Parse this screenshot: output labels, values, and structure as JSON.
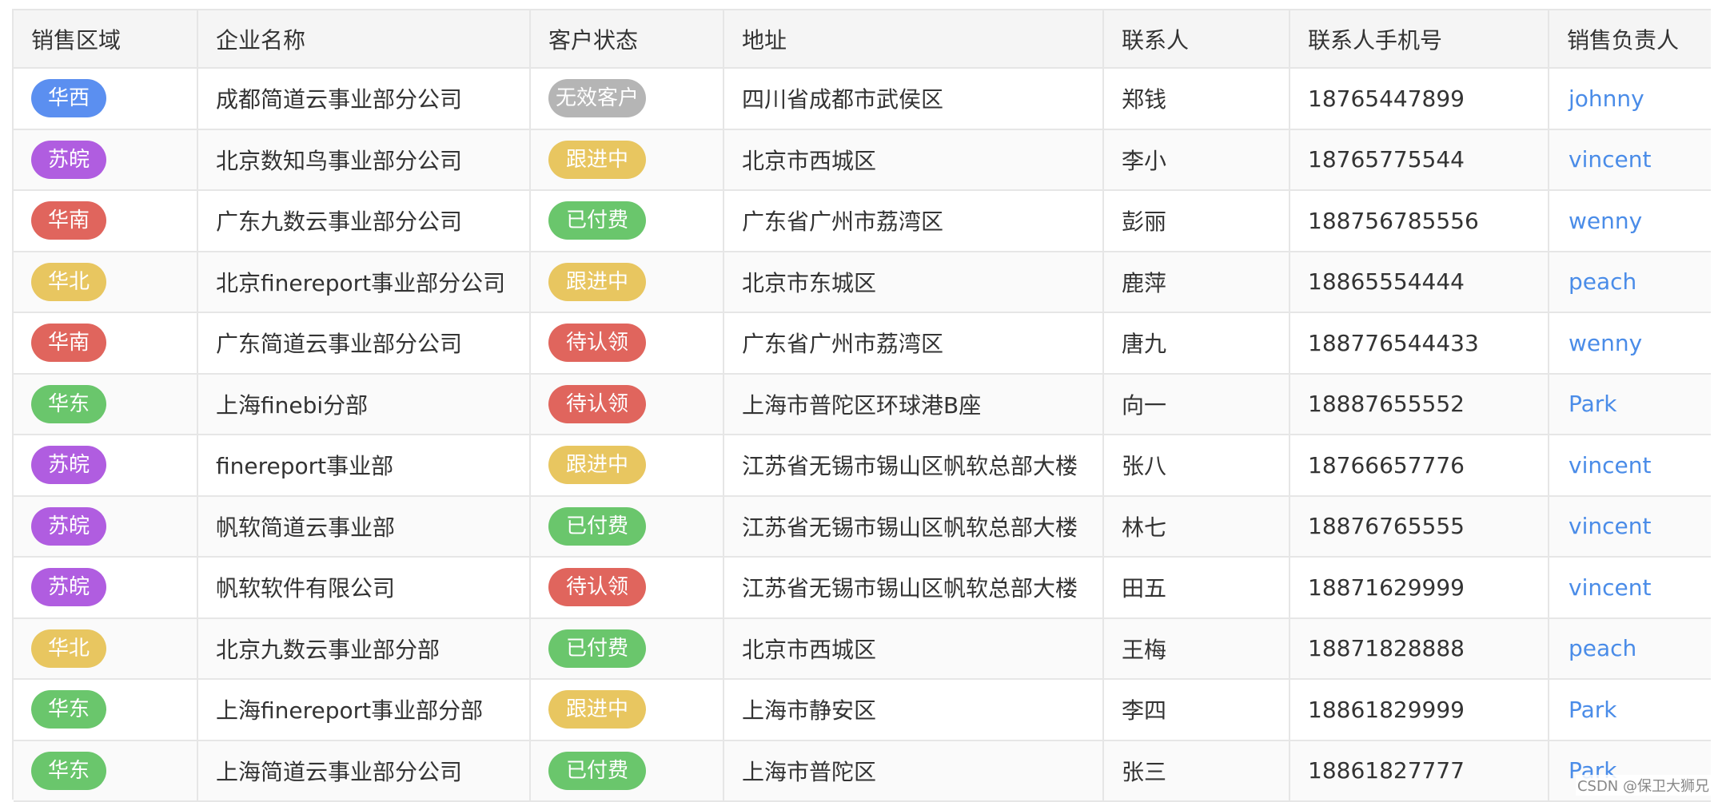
{
  "table": {
    "headers": [
      "销售区域",
      "企业名称",
      "客户状态",
      "地址",
      "联系人",
      "联系人手机号",
      "销售负责人"
    ],
    "rows": [
      {
        "region": "华西",
        "region_color": "#5b8ff0",
        "company": "成都简道云事业部分公司",
        "status": "无效客户",
        "status_color": "#b5b5b5",
        "address": "四川省成都市武侯区",
        "contact": "郑钱",
        "phone": "18765447899",
        "sales": "johnny"
      },
      {
        "region": "苏皖",
        "region_color": "#b05de0",
        "company": "北京数知鸟事业部分公司",
        "status": "跟进中",
        "status_color": "#e8c660",
        "address": "北京市西城区",
        "contact": "李小",
        "phone": "18765775544",
        "sales": "vincent"
      },
      {
        "region": "华南",
        "region_color": "#e0655d",
        "company": "广东九数云事业部分公司",
        "status": "已付费",
        "status_color": "#6ac66c",
        "address": "广东省广州市荔湾区",
        "contact": "彭丽",
        "phone": "188756785556",
        "sales": "wenny"
      },
      {
        "region": "华北",
        "region_color": "#e8c660",
        "company": "北京finereport事业部分公司",
        "status": "跟进中",
        "status_color": "#e8c660",
        "address": "北京市东城区",
        "contact": "鹿萍",
        "phone": "18865554444",
        "sales": "peach"
      },
      {
        "region": "华南",
        "region_color": "#e0655d",
        "company": "广东简道云事业部分公司",
        "status": "待认领",
        "status_color": "#e0655d",
        "address": "广东省广州市荔湾区",
        "contact": "唐九",
        "phone": "188776544433",
        "sales": "wenny"
      },
      {
        "region": "华东",
        "region_color": "#6ac66c",
        "company": "上海finebi分部",
        "status": "待认领",
        "status_color": "#e0655d",
        "address": "上海市普陀区环球港B座",
        "contact": "向一",
        "phone": "18887655552",
        "sales": "Park"
      },
      {
        "region": "苏皖",
        "region_color": "#b05de0",
        "company": "finereport事业部",
        "status": "跟进中",
        "status_color": "#e8c660",
        "address": "江苏省无锡市锡山区帆软总部大楼",
        "contact": "张八",
        "phone": "18766657776",
        "sales": "vincent"
      },
      {
        "region": "苏皖",
        "region_color": "#b05de0",
        "company": "帆软简道云事业部",
        "status": "已付费",
        "status_color": "#6ac66c",
        "address": "江苏省无锡市锡山区帆软总部大楼",
        "contact": "林七",
        "phone": "18876765555",
        "sales": "vincent"
      },
      {
        "region": "苏皖",
        "region_color": "#b05de0",
        "company": "帆软软件有限公司",
        "status": "待认领",
        "status_color": "#e0655d",
        "address": "江苏省无锡市锡山区帆软总部大楼",
        "contact": "田五",
        "phone": "18871629999",
        "sales": "vincent"
      },
      {
        "region": "华北",
        "region_color": "#e8c660",
        "company": "北京九数云事业部分部",
        "status": "已付费",
        "status_color": "#6ac66c",
        "address": "北京市西城区",
        "contact": "王梅",
        "phone": "18871828888",
        "sales": "peach"
      },
      {
        "region": "华东",
        "region_color": "#6ac66c",
        "company": "上海finereport事业部分部",
        "status": "跟进中",
        "status_color": "#e8c660",
        "address": "上海市静安区",
        "contact": "李四",
        "phone": "18861829999",
        "sales": "Park"
      },
      {
        "region": "华东",
        "region_color": "#6ac66c",
        "company": "上海简道云事业部分公司",
        "status": "已付费",
        "status_color": "#6ac66c",
        "address": "上海市普陀区",
        "contact": "张三",
        "phone": "18861827777",
        "sales": "Park"
      }
    ]
  },
  "watermark": "CSDN @保卫大狮兄",
  "colors": {
    "link": "#4a8ce8",
    "border": "#e6e6e6",
    "header_bg": "#f5f5f5"
  }
}
